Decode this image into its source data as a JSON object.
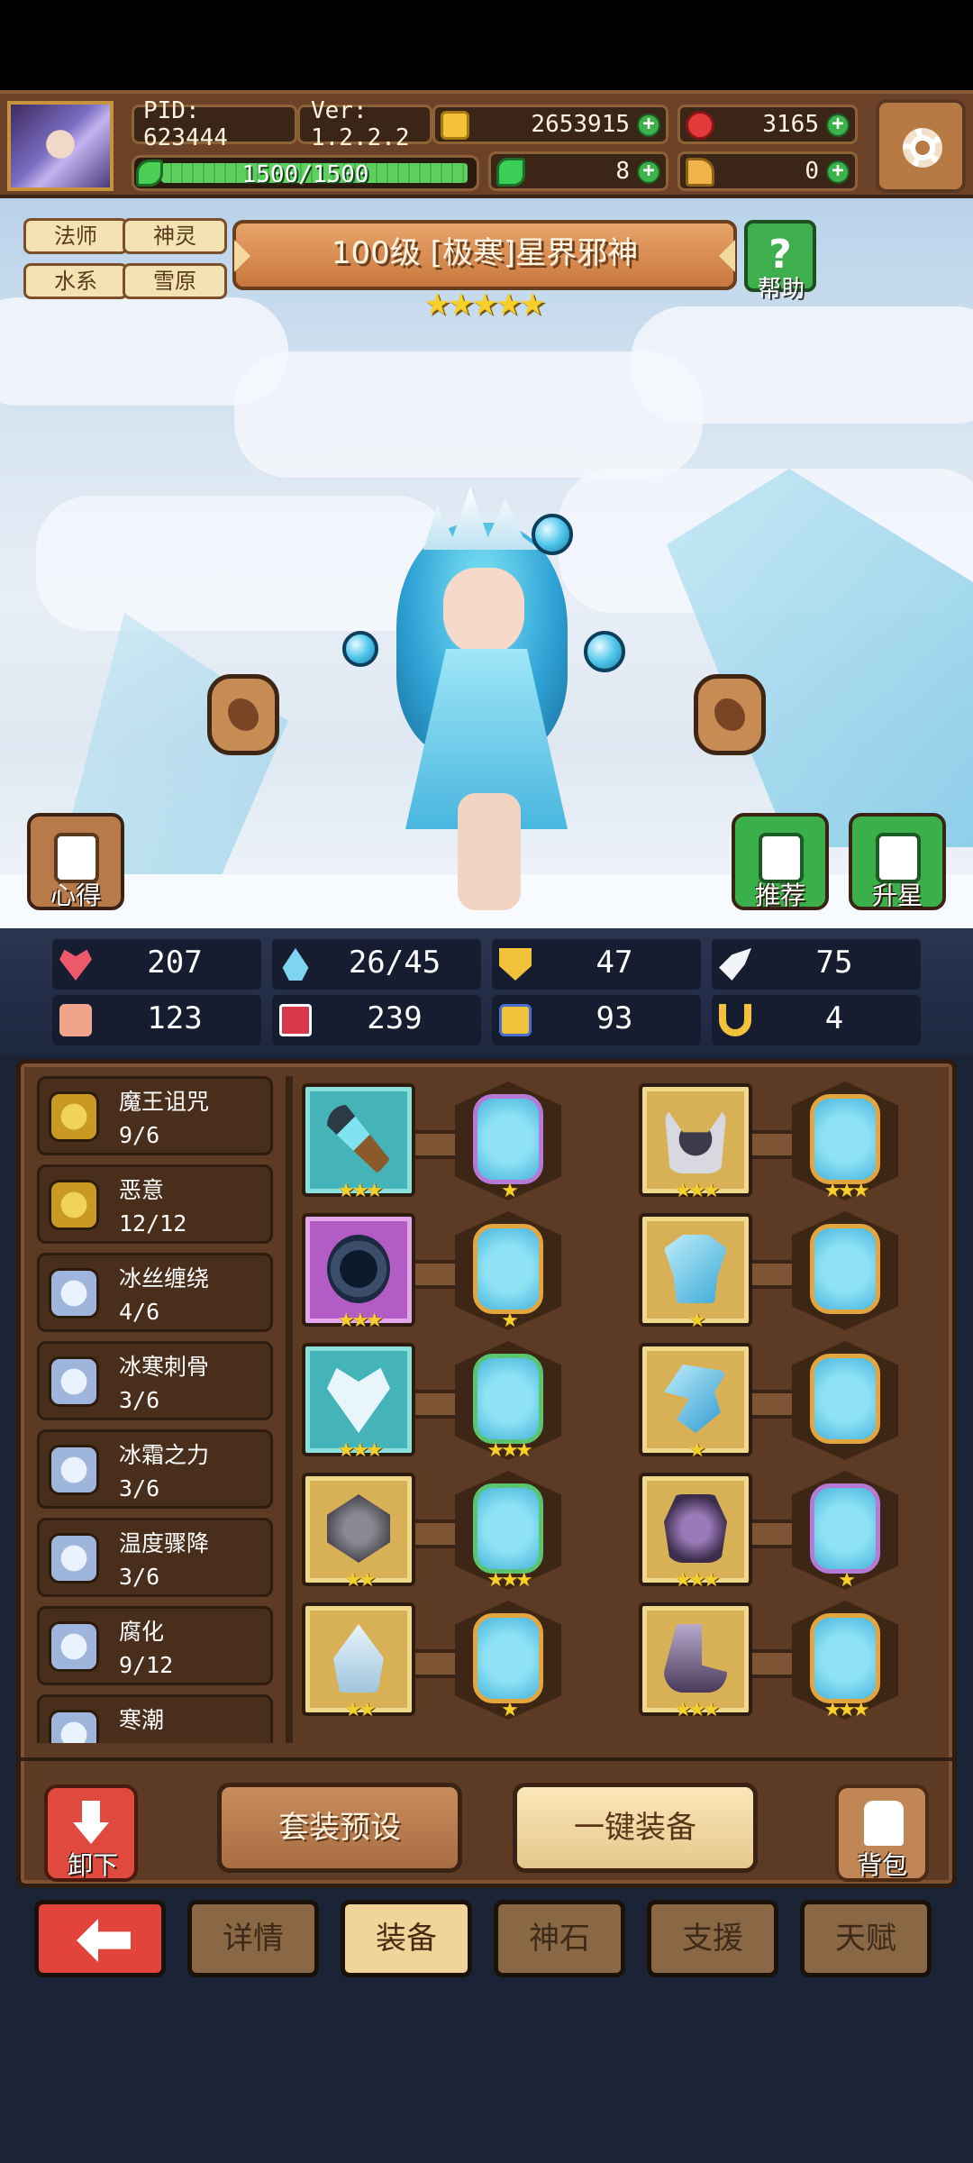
{
  "header": {
    "pid": "PID: 623444",
    "version": "Ver: 1.2.2.2",
    "coins": "2653915",
    "rubies": "3165",
    "clovers": "8",
    "boots": "0",
    "stamina": "1500/1500",
    "stamina_fraction": 1.0
  },
  "hero": {
    "tags": [
      "法师",
      "神灵",
      "水系",
      "雪原"
    ],
    "title": "100级 [极寒]星界邪神",
    "stars": "★★★★★",
    "star_count": 5,
    "help_label": "帮助",
    "insight_label": "心得",
    "recommend_label": "推荐",
    "star_up_label": "升星"
  },
  "stats": [
    {
      "icon": "heart-icon",
      "value": "207"
    },
    {
      "icon": "mana-drop-icon",
      "value": "26/45"
    },
    {
      "icon": "shield-icon",
      "value": "47"
    },
    {
      "icon": "wing-icon",
      "value": "75"
    },
    {
      "icon": "fist-icon",
      "value": "123"
    },
    {
      "icon": "spellbook-icon",
      "value": "239"
    },
    {
      "icon": "boot-icon",
      "value": "93"
    },
    {
      "icon": "magnet-icon",
      "value": "4"
    }
  ],
  "skills": [
    {
      "name": "魔王诅咒",
      "progress": "9/6",
      "icon": "gold"
    },
    {
      "name": "恶意",
      "progress": "12/12",
      "icon": "gold"
    },
    {
      "name": "冰丝缠绕",
      "progress": "4/6",
      "icon": "ice"
    },
    {
      "name": "冰寒刺骨",
      "progress": "3/6",
      "icon": "ice"
    },
    {
      "name": "冰霜之力",
      "progress": "3/6",
      "icon": "ice"
    },
    {
      "name": "温度骤降",
      "progress": "3/6",
      "icon": "ice"
    },
    {
      "name": "腐化",
      "progress": "9/12",
      "icon": "ice"
    },
    {
      "name": "寒潮",
      "progress": "",
      "icon": "ice"
    }
  ],
  "equipment_left": [
    {
      "item": "ice-staff-icon",
      "rarity": "teal",
      "stars": "★★★",
      "gem_frame": "purple",
      "gem_stars": "★"
    },
    {
      "item": "dark-orb-icon",
      "rarity": "purple",
      "stars": "★★★",
      "gem_frame": "gold",
      "gem_stars": "★"
    },
    {
      "item": "heart-necklace-icon",
      "rarity": "teal",
      "stars": "★★★",
      "gem_frame": "green",
      "gem_stars": "★★★"
    },
    {
      "item": "stone-ring-icon",
      "rarity": "gold",
      "stars": "★★",
      "gem_frame": "green",
      "gem_stars": "★★★"
    },
    {
      "item": "ice-crown-icon",
      "rarity": "gold",
      "stars": "★★",
      "gem_frame": "gold",
      "gem_stars": "★"
    }
  ],
  "equipment_right": [
    {
      "item": "horned-helm-icon",
      "rarity": "gold",
      "stars": "★★★",
      "gem_frame": "gold",
      "gem_stars": "★★★"
    },
    {
      "item": "ice-armor-icon",
      "rarity": "gold",
      "stars": "★",
      "gem_frame": "gold",
      "gem_stars": ""
    },
    {
      "item": "ice-feather-icon",
      "rarity": "gold",
      "stars": "★",
      "gem_frame": "gold",
      "gem_stars": ""
    },
    {
      "item": "dark-gauntlet-icon",
      "rarity": "gold",
      "stars": "★★★",
      "gem_frame": "purple",
      "gem_stars": "★"
    },
    {
      "item": "armored-boots-icon",
      "rarity": "gold",
      "stars": "★★★",
      "gem_frame": "gold",
      "gem_stars": "★★★"
    }
  ],
  "actions": {
    "unload_label": "卸下",
    "preset_label": "套装预设",
    "equip_all_label": "一键装备",
    "bag_label": "背包"
  },
  "nav": {
    "tabs": [
      "详情",
      "装备",
      "神石",
      "支援",
      "天赋"
    ],
    "active": "装备"
  }
}
